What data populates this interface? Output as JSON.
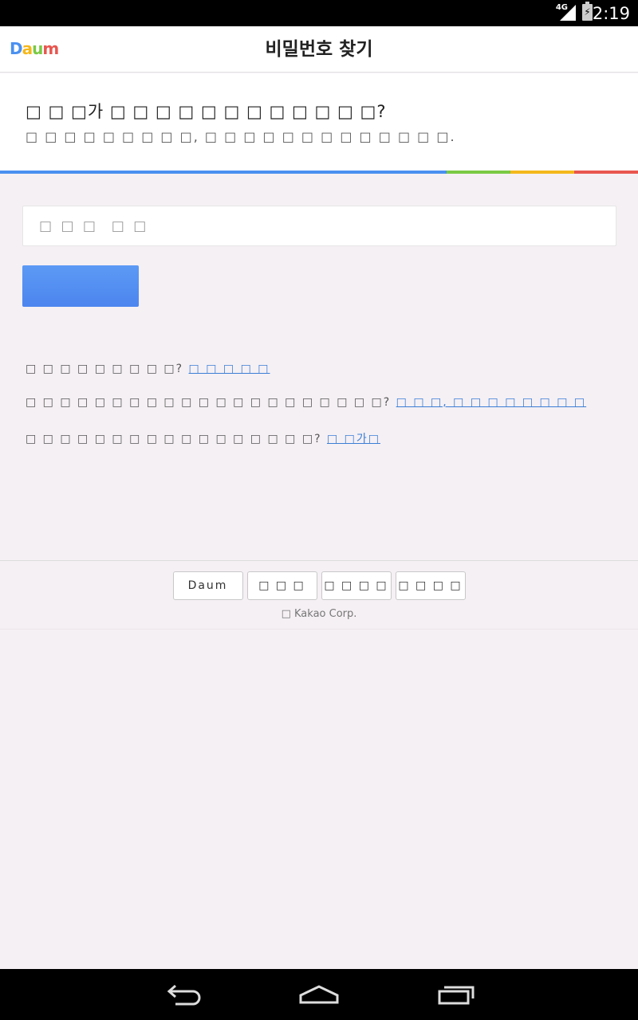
{
  "status_bar": {
    "network": "4G",
    "time": "2:19"
  },
  "header": {
    "logo": {
      "d": "D",
      "a": "a",
      "u": "u",
      "m": "m"
    },
    "title": "비밀번호 찾기"
  },
  "intro": {
    "headline": "□ □ □가 □ □ □ □  □ □  □ □ □ □ □ □?",
    "description": "□ □ □ □  □ □ □ □ □,  □ □  □  □ □  □ □ □  □ □ □ □ □."
  },
  "accent_colors": {
    "blue": "#4a90f0",
    "green": "#7ac943",
    "yellow": "#f4b81c",
    "red": "#e8564f"
  },
  "form": {
    "id_placeholder": "□ □ □  □ □",
    "next_button_label": ""
  },
  "help": [
    {
      "text": "□ □ □ □  □ □ □ □ □?",
      "link": "□ □ □  □ □"
    },
    {
      "text": "□ □ □  □ □ □  □ □  □ □ □  □ □ □ □  □ □ □ □ □ □?",
      "link": "□ □ □, □ □ □  □ □ □  □ □"
    },
    {
      "text": "□ □ □ □ □  □ □ □ □  □ □ □  □ □ □ □ □?",
      "link": "□ □가□"
    }
  ],
  "footer": {
    "links": [
      "Daum",
      "□ □ □",
      "□ □ □ □",
      "□ □ □ □"
    ],
    "copyright": "□ Kakao Corp."
  }
}
